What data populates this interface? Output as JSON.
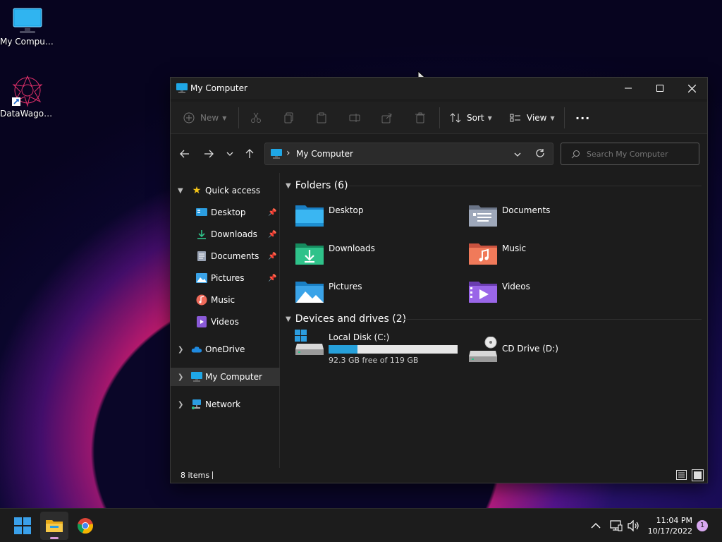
{
  "desktop": {
    "icons": [
      {
        "label": "My Computer"
      },
      {
        "label": "DataWagon..."
      }
    ]
  },
  "window": {
    "title": "My Computer",
    "toolbar": {
      "new_label": "New",
      "sort_label": "Sort",
      "view_label": "View",
      "more_label": "···"
    },
    "address": {
      "path_label": "My Computer",
      "separator": "›"
    },
    "search": {
      "placeholder": "Search My Computer"
    },
    "sidebar": {
      "items": [
        {
          "label": "Quick access"
        },
        {
          "label": "Desktop"
        },
        {
          "label": "Downloads"
        },
        {
          "label": "Documents"
        },
        {
          "label": "Pictures"
        },
        {
          "label": "Music"
        },
        {
          "label": "Videos"
        },
        {
          "label": "OneDrive"
        },
        {
          "label": "My Computer"
        },
        {
          "label": "Network"
        }
      ]
    },
    "folders_section": {
      "heading": "Folders (6)",
      "items": [
        {
          "label": "Desktop"
        },
        {
          "label": "Documents"
        },
        {
          "label": "Downloads"
        },
        {
          "label": "Music"
        },
        {
          "label": "Pictures"
        },
        {
          "label": "Videos"
        }
      ]
    },
    "drives_section": {
      "heading": "Devices and drives (2)",
      "local_disk": {
        "label": "Local Disk (C:)",
        "free_text": "92.3 GB free of 119 GB",
        "used_fraction": 0.224
      },
      "cd_drive": {
        "label": "CD Drive (D:)"
      }
    },
    "status": {
      "items_text": "8 items"
    }
  },
  "taskbar": {
    "time": "11:04 PM",
    "date": "10/17/2022",
    "notification_count": "1"
  },
  "colors": {
    "accent": "#3a9ee0",
    "drive_bar_fill": "#26a0da",
    "drive_bar_bg": "#e6e6e6",
    "badge": "#d8a8f0"
  }
}
